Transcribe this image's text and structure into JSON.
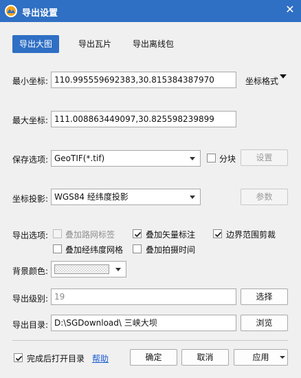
{
  "window": {
    "title": "导出设置",
    "close_glyph": "✕"
  },
  "tabs": [
    {
      "label": "导出大图",
      "active": true
    },
    {
      "label": "导出瓦片",
      "active": false
    },
    {
      "label": "导出离线包",
      "active": false
    }
  ],
  "min_coord": {
    "label": "最小坐标:",
    "value": "110.995559692383,30.815384387970"
  },
  "coord_format": {
    "label": "坐标格式"
  },
  "max_coord": {
    "label": "最大坐标:",
    "value": "111.008863449097,30.825598239899"
  },
  "save_option": {
    "label": "保存选项:",
    "value": "GeoTIF(*.tif)",
    "tile_label": "分块",
    "tile_checked": false,
    "settings_label": "设置"
  },
  "projection": {
    "label": "坐标投影:",
    "value": "WGS84 经纬度投影",
    "params_label": "参数"
  },
  "export_options": {
    "label": "导出选项:",
    "items": [
      {
        "label": "叠加路网标签",
        "checked": false,
        "disabled": true
      },
      {
        "label": "叠加矢量标注",
        "checked": true,
        "disabled": false
      },
      {
        "label": "边界范围剪裁",
        "checked": true,
        "disabled": false
      },
      {
        "label": "叠加经纬度网格",
        "checked": false,
        "disabled": false
      },
      {
        "label": "叠加拍摄时间",
        "checked": false,
        "disabled": false
      }
    ]
  },
  "background": {
    "label": "背景颜色:"
  },
  "level": {
    "label": "导出级别:",
    "value": "19",
    "select_label": "选择"
  },
  "directory": {
    "label": "导出目录:",
    "value": "D:\\SGDownload\\ 三峡大坝",
    "browse_label": "浏览"
  },
  "footer": {
    "open_after_label": "完成后打开目录",
    "open_after_checked": true,
    "help_label": "帮助",
    "ok_label": "确定",
    "cancel_label": "取消",
    "apply_label": "应用"
  },
  "colors": {
    "titlebar": "#2f6fc4",
    "accent": "#2f6fc4",
    "link": "#1a5bd1"
  }
}
